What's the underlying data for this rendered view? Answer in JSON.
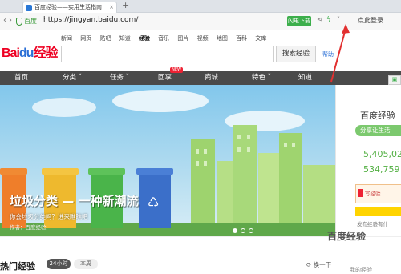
{
  "browser": {
    "tab_title": "百度经验——实用生活指南",
    "url": "https://jingyan.baidu.com/",
    "site_label": "百度",
    "speedup_label": "闪电下载",
    "right_label": "点此登录",
    "new_tab_icon": "+"
  },
  "header": {
    "logo_left": "Bai",
    "logo_paw": "du",
    "logo_right": "经验",
    "nav_links": [
      "新闻",
      "网页",
      "贴吧",
      "知道",
      "经验",
      "音乐",
      "图片",
      "视频",
      "地图",
      "百科",
      "文库"
    ],
    "search_button": "搜索经验",
    "help": "帮助"
  },
  "mainnav": {
    "items": [
      "首页",
      "分类 ˅",
      "任务 ˅",
      "回享",
      "商城",
      "特色 ˅",
      "知道"
    ],
    "new_badge": "NEW"
  },
  "hero": {
    "title": "垃圾分类 — 一种新潮流",
    "subtitle": "你会垃圾分类吗？进来瞧瞧吧",
    "author": "作者：百度经验"
  },
  "right_panel": {
    "title": "百度经验",
    "slogan": "分享让生活",
    "number1": "5,405,027",
    "number2": "534,759",
    "box_label": "写经验",
    "publish": "发布经验有什"
  },
  "bottom": {
    "hot_title": "热门经验",
    "pill_24h": "24小时",
    "pill_week": "本周",
    "refresh": "换一下",
    "my_exp": "我的经验"
  },
  "watermark": "百度经验",
  "colors": {
    "accent_green": "#4fae3f",
    "nav_dark": "#4a4a4a",
    "annotation_red": "#e23030"
  }
}
